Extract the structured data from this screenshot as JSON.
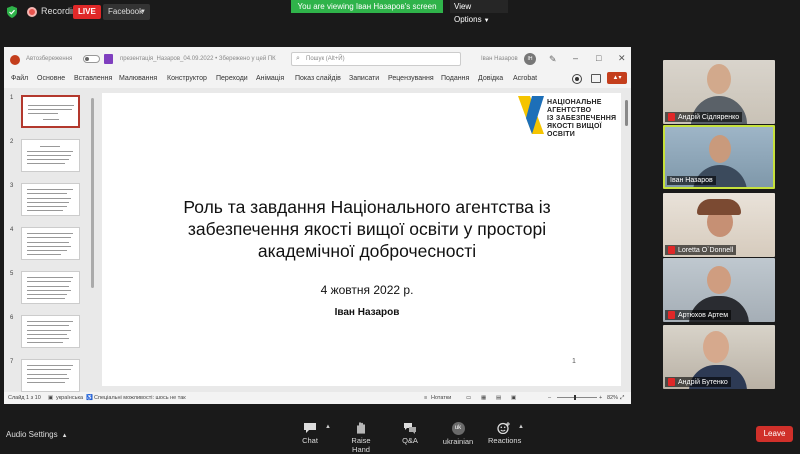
{
  "zoom_bar": {
    "recording_label": "Recording",
    "live_label": "LIVE",
    "facebook_label": "Facebook",
    "viewing_banner": "You are viewing Іван Назаров's screen",
    "view_options_label": "View Options"
  },
  "ppt": {
    "autosave_label": "Автозбереження",
    "document_name": "презентація_Назаров_04.09.2022 • Збережено у цей ПК",
    "search_placeholder": "Пошук (Alt+Й)",
    "user_name": "Іван Назаров",
    "user_initials": "ІН",
    "menu": [
      "Файл",
      "Основне",
      "Вставлення",
      "Малювання",
      "Конструктор",
      "Переходи",
      "Анімація",
      "Показ слайдів",
      "Записати",
      "Рецензування",
      "Подання",
      "Довідка",
      "Acrobat"
    ],
    "thumbnail_numbers": [
      "1",
      "2",
      "3",
      "4",
      "5",
      "6",
      "7"
    ],
    "slide": {
      "logo_lines": [
        "НАЦІОНАЛЬНЕ",
        "АГЕНТСТВО",
        "ІЗ ЗАБЕЗПЕЧЕННЯ",
        "ЯКОСТІ ВИЩОЇ ОСВІТИ"
      ],
      "title_lines": [
        "Роль та завдання Національного агентства із",
        "забезпечення якості вищої освіти у просторі",
        "академічної доброчесності"
      ],
      "date": "4 жовтня 2022 р.",
      "author": "Іван Назаров",
      "page_number": "1"
    },
    "status": {
      "slide_counter": "Слайд 1 з 10",
      "language": "українська",
      "accessibility": "Спеціальні можливості: шось не так",
      "notes": "Нотатки",
      "zoom": "82%"
    },
    "colors": {
      "accent": "#c43e1c",
      "logo_yellow": "#f5c400",
      "logo_blue": "#1d6fb8"
    }
  },
  "participants": [
    {
      "name": "Андрій Сідляренко",
      "muted": true
    },
    {
      "name": "Іван Назаров",
      "muted": false,
      "active": true
    },
    {
      "name": "Loretta O`Donnell",
      "muted": true
    },
    {
      "name": "Артюхов Артем",
      "muted": true
    },
    {
      "name": "Андрій Бутенко",
      "muted": true
    }
  ],
  "controls": {
    "audio_settings": "Audio Settings",
    "chat": "Chat",
    "raise_hand": "Raise Hand",
    "qa": "Q&A",
    "language": "ukrainian",
    "language_code": "uk",
    "reactions": "Reactions",
    "leave": "Leave"
  }
}
